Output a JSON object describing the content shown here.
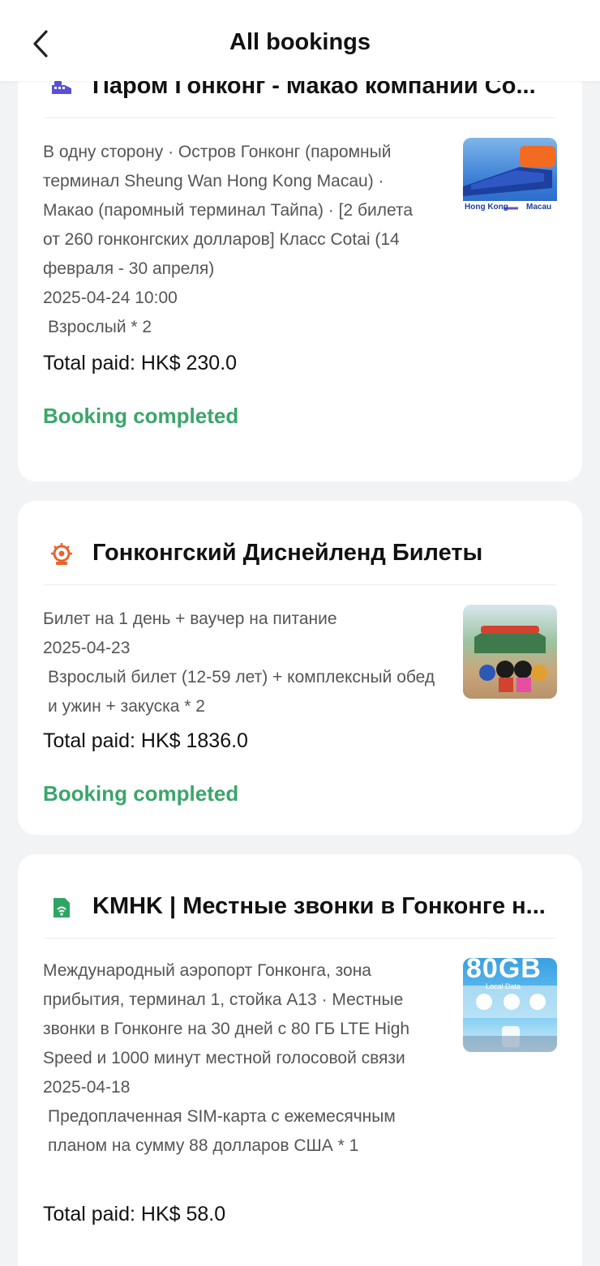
{
  "header": {
    "title": "All bookings"
  },
  "bookings": [
    {
      "category_icon": "ferry-icon",
      "icon_color": "#5a4fd8",
      "title": "Паром Гонконг - Макао компании Co...",
      "description": "В одну сторону · Остров Гонконг (паромный терминал Sheung Wan Hong Kong Macau) · Макао (паромный терминал Тайпа) · [2 билета от 260 гонконгских долларов] Класс Cotai (14 февраля - 30 апреля)",
      "date": "2025-04-24 10:00",
      "quantity": "Взрослый * 2",
      "total": "Total paid: HK$ 230.0",
      "status": "Booking completed",
      "thumb_labels": [
        "Hong Kong",
        "Macau"
      ]
    },
    {
      "category_icon": "attraction-icon",
      "icon_color": "#e8632c",
      "title": "Гонконгский Диснейленд Билеты",
      "description": "Билет на 1 день + ваучер на питание",
      "date": "2025-04-23",
      "quantity": "Взрослый билет (12-59 лет) + комплексный обед и ужин + закуска * 2",
      "total": "Total paid: HK$ 1836.0",
      "status": "Booking completed"
    },
    {
      "category_icon": "sim-card-icon",
      "icon_color": "#2fa463",
      "title": "KMHK | Местные звонки в Гонконге н...",
      "description": "Международный аэропорт Гонконга, зона прибытия, терминал 1, стойка A13 · Местные звонки в Гонконге на 30 дней с 80 ГБ LTE High Speed и 1000 минут местной голосовой связи",
      "date": "2025-04-18",
      "quantity": "Предоплаченная SIM-карта с ежемесячным планом на сумму 88 долларов США * 1",
      "total": "Total paid: HK$ 58.0",
      "thumb_labels": [
        "80GB",
        "Local Data"
      ]
    }
  ],
  "colors": {
    "status_green": "#3aa66a",
    "background": "#f2f3f5"
  }
}
